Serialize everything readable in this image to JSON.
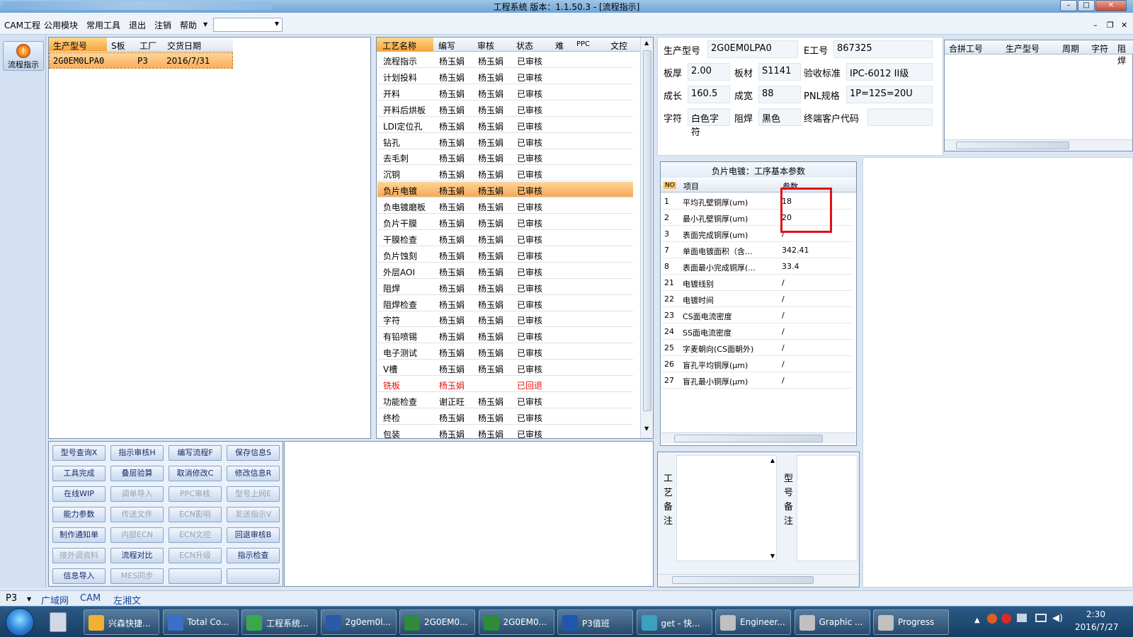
{
  "window": {
    "title": "工程系统   版本：1.1.50.3 - [流程指示]"
  },
  "menu": {
    "items": [
      "CAM工程",
      "公用模块",
      "常用工具",
      "退出",
      "注销",
      "帮助"
    ]
  },
  "sidebar": {
    "flow_button": "流程指示"
  },
  "order_grid": {
    "headers": [
      "生产型号",
      "S板",
      "工厂",
      "交货日期"
    ],
    "rows": [
      {
        "model": "2G0EM0LPA0",
        "s": "",
        "factory": "P3",
        "date": "2016/7/31"
      }
    ]
  },
  "process_grid": {
    "headers": [
      "工艺名称",
      "编写",
      "审核",
      "状态",
      "难",
      "PPC",
      "文控"
    ],
    "rows": [
      {
        "name": "流程指示",
        "writer": "杨玉娟",
        "reviewer": "杨玉娟",
        "status": "已审核"
      },
      {
        "name": "计划投料",
        "writer": "杨玉娟",
        "reviewer": "杨玉娟",
        "status": "已审核"
      },
      {
        "name": "开料",
        "writer": "杨玉娟",
        "reviewer": "杨玉娟",
        "status": "已审核"
      },
      {
        "name": "开料后烘板",
        "writer": "杨玉娟",
        "reviewer": "杨玉娟",
        "status": "已审核"
      },
      {
        "name": "LDI定位孔",
        "writer": "杨玉娟",
        "reviewer": "杨玉娟",
        "status": "已审核"
      },
      {
        "name": "钻孔",
        "writer": "杨玉娟",
        "reviewer": "杨玉娟",
        "status": "已审核"
      },
      {
        "name": "去毛刺",
        "writer": "杨玉娟",
        "reviewer": "杨玉娟",
        "status": "已审核"
      },
      {
        "name": "沉铜",
        "writer": "杨玉娟",
        "reviewer": "杨玉娟",
        "status": "已审核"
      },
      {
        "name": "负片电镀",
        "writer": "杨玉娟",
        "reviewer": "杨玉娟",
        "status": "已审核"
      },
      {
        "name": "负电镀磨板",
        "writer": "杨玉娟",
        "reviewer": "杨玉娟",
        "status": "已审核"
      },
      {
        "name": "负片干膜",
        "writer": "杨玉娟",
        "reviewer": "杨玉娟",
        "status": "已审核"
      },
      {
        "name": "干膜检查",
        "writer": "杨玉娟",
        "reviewer": "杨玉娟",
        "status": "已审核"
      },
      {
        "name": "负片蚀刻",
        "writer": "杨玉娟",
        "reviewer": "杨玉娟",
        "status": "已审核"
      },
      {
        "name": "外层AOI",
        "writer": "杨玉娟",
        "reviewer": "杨玉娟",
        "status": "已审核"
      },
      {
        "name": "阻焊",
        "writer": "杨玉娟",
        "reviewer": "杨玉娟",
        "status": "已审核"
      },
      {
        "name": "阻焊检查",
        "writer": "杨玉娟",
        "reviewer": "杨玉娟",
        "status": "已审核"
      },
      {
        "name": "字符",
        "writer": "杨玉娟",
        "reviewer": "杨玉娟",
        "status": "已审核"
      },
      {
        "name": "有铅喷锡",
        "writer": "杨玉娟",
        "reviewer": "杨玉娟",
        "status": "已审核"
      },
      {
        "name": "电子测试",
        "writer": "杨玉娟",
        "reviewer": "杨玉娟",
        "status": "已审核"
      },
      {
        "name": "V槽",
        "writer": "杨玉娟",
        "reviewer": "杨玉娟",
        "status": "已审核"
      },
      {
        "name": "铣板",
        "writer": "杨玉娟",
        "reviewer": "",
        "status": "已回退"
      },
      {
        "name": "功能检查",
        "writer": "谢正旺",
        "reviewer": "杨玉娟",
        "status": "已审核"
      },
      {
        "name": "终检",
        "writer": "杨玉娟",
        "reviewer": "杨玉娟",
        "status": "已审核"
      },
      {
        "name": "包装",
        "writer": "杨玉娟",
        "reviewer": "杨玉娟",
        "status": "已审核"
      }
    ]
  },
  "function_buttons": [
    [
      "型号查询X",
      "指示审核H",
      "编写流程F",
      "保存信息S"
    ],
    [
      "工具完成",
      "叠层验算",
      "取消修改C",
      "修改信息R"
    ],
    [
      "在线WIP",
      "调单导入",
      "PPC审核",
      "型号上网E"
    ],
    [
      "能力参数",
      "传送文件",
      "ECN影响",
      "发送指示V"
    ],
    [
      "制作通知单",
      "内部ECN",
      "ECN文控",
      "回退审核B"
    ],
    [
      "接外调资料",
      "流程对比",
      "ECN升级",
      "指示检查"
    ],
    [
      "信息导入",
      "MES同步",
      "",
      ""
    ]
  ],
  "info": {
    "model_label": "生产型号",
    "model": "2G0EM0LPA0",
    "eno_label": "E工号",
    "eno": "867325",
    "thick_label": "板厚",
    "thick": "2.00",
    "mat_label": "板材",
    "mat": "S1141",
    "std_label": "验收标准",
    "std": "IPC-6012 II级",
    "len_label": "成长",
    "len": "160.5",
    "wid_label": "成宽",
    "wid": "88",
    "pnl_label": "PNL规格",
    "pnl": "1P=12S=20U",
    "char_label": "字符",
    "char": "白色字符",
    "mask_label": "阻焊",
    "mask": "黑色",
    "cust_label": "终端客户代码",
    "cust": ""
  },
  "merge_grid": {
    "headers": [
      "合拼工号",
      "生产型号",
      "周期",
      "字符",
      "阻焊"
    ]
  },
  "params": {
    "title": "负片电镀：工序基本参数",
    "headers": [
      "NO",
      "项目",
      "参数"
    ],
    "rows": [
      {
        "no": "1",
        "item": "平均孔壁铜厚(um)",
        "val": "18"
      },
      {
        "no": "2",
        "item": "最小孔壁铜厚(um)",
        "val": "20"
      },
      {
        "no": "3",
        "item": "表面完成铜厚(um)",
        "val": "/"
      },
      {
        "no": "7",
        "item": "单面电镀面积（含...",
        "val": "342.41"
      },
      {
        "no": "8",
        "item": "表面最小完成铜厚(...",
        "val": "33.4"
      },
      {
        "no": "21",
        "item": "电镀线别",
        "val": "/"
      },
      {
        "no": "22",
        "item": "电镀时间",
        "val": "/"
      },
      {
        "no": "23",
        "item": "CS面电流密度",
        "val": "/"
      },
      {
        "no": "24",
        "item": "SS面电流密度",
        "val": "/"
      },
      {
        "no": "25",
        "item": "字麦朝向(CS面朝外)",
        "val": "/"
      },
      {
        "no": "26",
        "item": "盲孔平均铜厚(μm)",
        "val": "/"
      },
      {
        "no": "27",
        "item": "盲孔最小铜厚(μm)",
        "val": "/"
      }
    ]
  },
  "notes": {
    "process_note": "工艺备注",
    "model_note": "型号备注"
  },
  "status": {
    "plant": "P3",
    "items": [
      "广域网",
      "CAM",
      "左湘文"
    ]
  },
  "taskbar": {
    "items": [
      "兴森快捷...",
      "Total Co...",
      "工程系统...",
      "2g0em0l...",
      "2G0EM0...",
      "2G0EM0...",
      "P3值班",
      "get - 快...",
      "Engineer...",
      "Graphic ...",
      "Progress"
    ],
    "time": "2:30",
    "date": "2016/7/27"
  },
  "colors": {
    "accent": "#f6a23a",
    "highlight": "#e0101a"
  }
}
